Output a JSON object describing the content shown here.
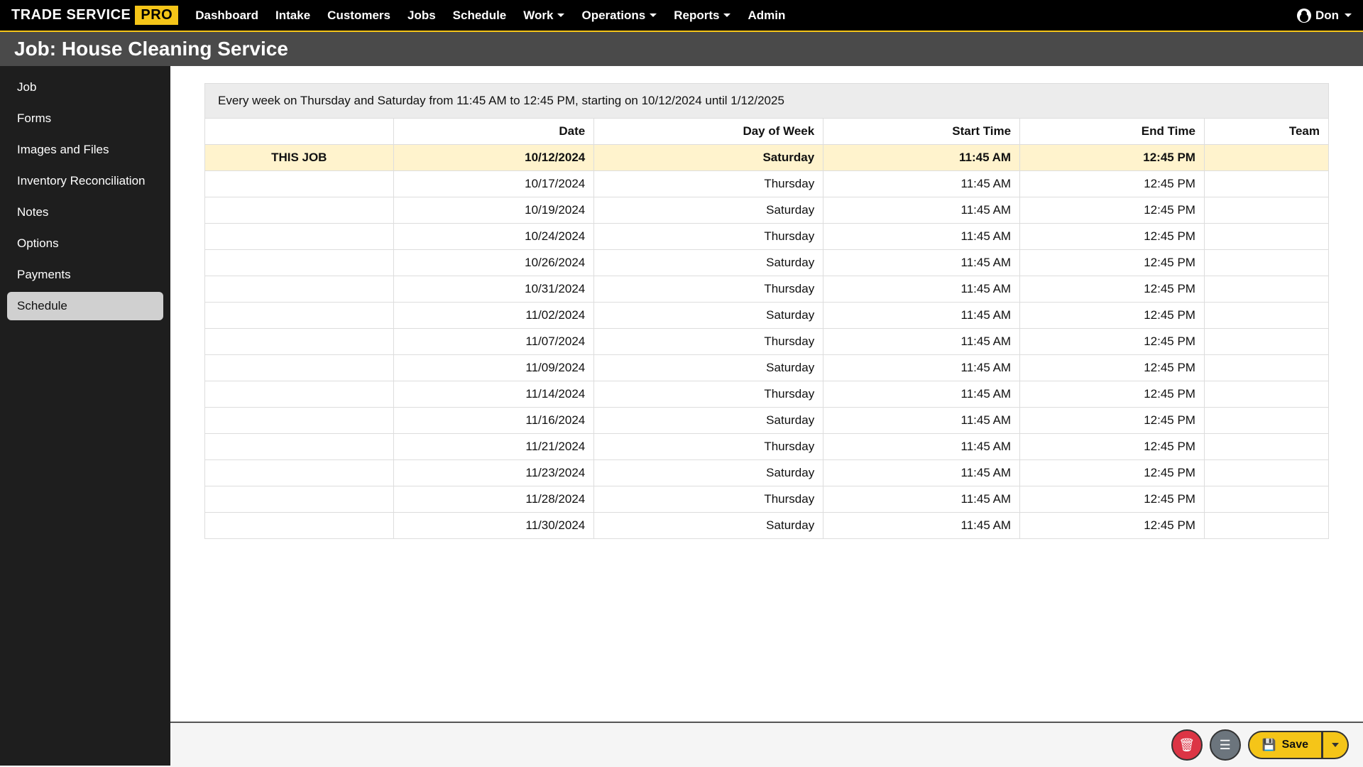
{
  "brand": {
    "name": "TRADE SERVICE",
    "badge": "PRO"
  },
  "nav": {
    "items": [
      {
        "label": "Dashboard",
        "dropdown": false
      },
      {
        "label": "Intake",
        "dropdown": false
      },
      {
        "label": "Customers",
        "dropdown": false
      },
      {
        "label": "Jobs",
        "dropdown": false
      },
      {
        "label": "Schedule",
        "dropdown": false
      },
      {
        "label": "Work",
        "dropdown": true
      },
      {
        "label": "Operations",
        "dropdown": true
      },
      {
        "label": "Reports",
        "dropdown": true
      },
      {
        "label": "Admin",
        "dropdown": false
      }
    ],
    "user": "Don"
  },
  "page_title": "Job: House Cleaning Service",
  "sidebar": {
    "items": [
      {
        "label": "Job",
        "active": false
      },
      {
        "label": "Forms",
        "active": false
      },
      {
        "label": "Images and Files",
        "active": false
      },
      {
        "label": "Inventory Reconciliation",
        "active": false
      },
      {
        "label": "Notes",
        "active": false
      },
      {
        "label": "Options",
        "active": false
      },
      {
        "label": "Payments",
        "active": false
      },
      {
        "label": "Schedule",
        "active": true
      }
    ]
  },
  "schedule": {
    "caption": "Every week on Thursday and Saturday from 11:45 AM to 12:45 PM, starting on 10/12/2024 until 1/12/2025",
    "columns": [
      "",
      "Date",
      "Day of Week",
      "Start Time",
      "End Time",
      "Team"
    ],
    "rows": [
      {
        "tag": "THIS JOB",
        "date": "10/12/2024",
        "dow": "Saturday",
        "start": "11:45 AM",
        "end": "12:45 PM",
        "team": "",
        "highlight": true
      },
      {
        "tag": "",
        "date": "10/17/2024",
        "dow": "Thursday",
        "start": "11:45 AM",
        "end": "12:45 PM",
        "team": "",
        "highlight": false
      },
      {
        "tag": "",
        "date": "10/19/2024",
        "dow": "Saturday",
        "start": "11:45 AM",
        "end": "12:45 PM",
        "team": "",
        "highlight": false
      },
      {
        "tag": "",
        "date": "10/24/2024",
        "dow": "Thursday",
        "start": "11:45 AM",
        "end": "12:45 PM",
        "team": "",
        "highlight": false
      },
      {
        "tag": "",
        "date": "10/26/2024",
        "dow": "Saturday",
        "start": "11:45 AM",
        "end": "12:45 PM",
        "team": "",
        "highlight": false
      },
      {
        "tag": "",
        "date": "10/31/2024",
        "dow": "Thursday",
        "start": "11:45 AM",
        "end": "12:45 PM",
        "team": "",
        "highlight": false
      },
      {
        "tag": "",
        "date": "11/02/2024",
        "dow": "Saturday",
        "start": "11:45 AM",
        "end": "12:45 PM",
        "team": "",
        "highlight": false
      },
      {
        "tag": "",
        "date": "11/07/2024",
        "dow": "Thursday",
        "start": "11:45 AM",
        "end": "12:45 PM",
        "team": "",
        "highlight": false
      },
      {
        "tag": "",
        "date": "11/09/2024",
        "dow": "Saturday",
        "start": "11:45 AM",
        "end": "12:45 PM",
        "team": "",
        "highlight": false
      },
      {
        "tag": "",
        "date": "11/14/2024",
        "dow": "Thursday",
        "start": "11:45 AM",
        "end": "12:45 PM",
        "team": "",
        "highlight": false
      },
      {
        "tag": "",
        "date": "11/16/2024",
        "dow": "Saturday",
        "start": "11:45 AM",
        "end": "12:45 PM",
        "team": "",
        "highlight": false
      },
      {
        "tag": "",
        "date": "11/21/2024",
        "dow": "Thursday",
        "start": "11:45 AM",
        "end": "12:45 PM",
        "team": "",
        "highlight": false
      },
      {
        "tag": "",
        "date": "11/23/2024",
        "dow": "Saturday",
        "start": "11:45 AM",
        "end": "12:45 PM",
        "team": "",
        "highlight": false
      },
      {
        "tag": "",
        "date": "11/28/2024",
        "dow": "Thursday",
        "start": "11:45 AM",
        "end": "12:45 PM",
        "team": "",
        "highlight": false
      },
      {
        "tag": "",
        "date": "11/30/2024",
        "dow": "Saturday",
        "start": "11:45 AM",
        "end": "12:45 PM",
        "team": "",
        "highlight": false
      }
    ]
  },
  "footer": {
    "save_label": "Save"
  }
}
